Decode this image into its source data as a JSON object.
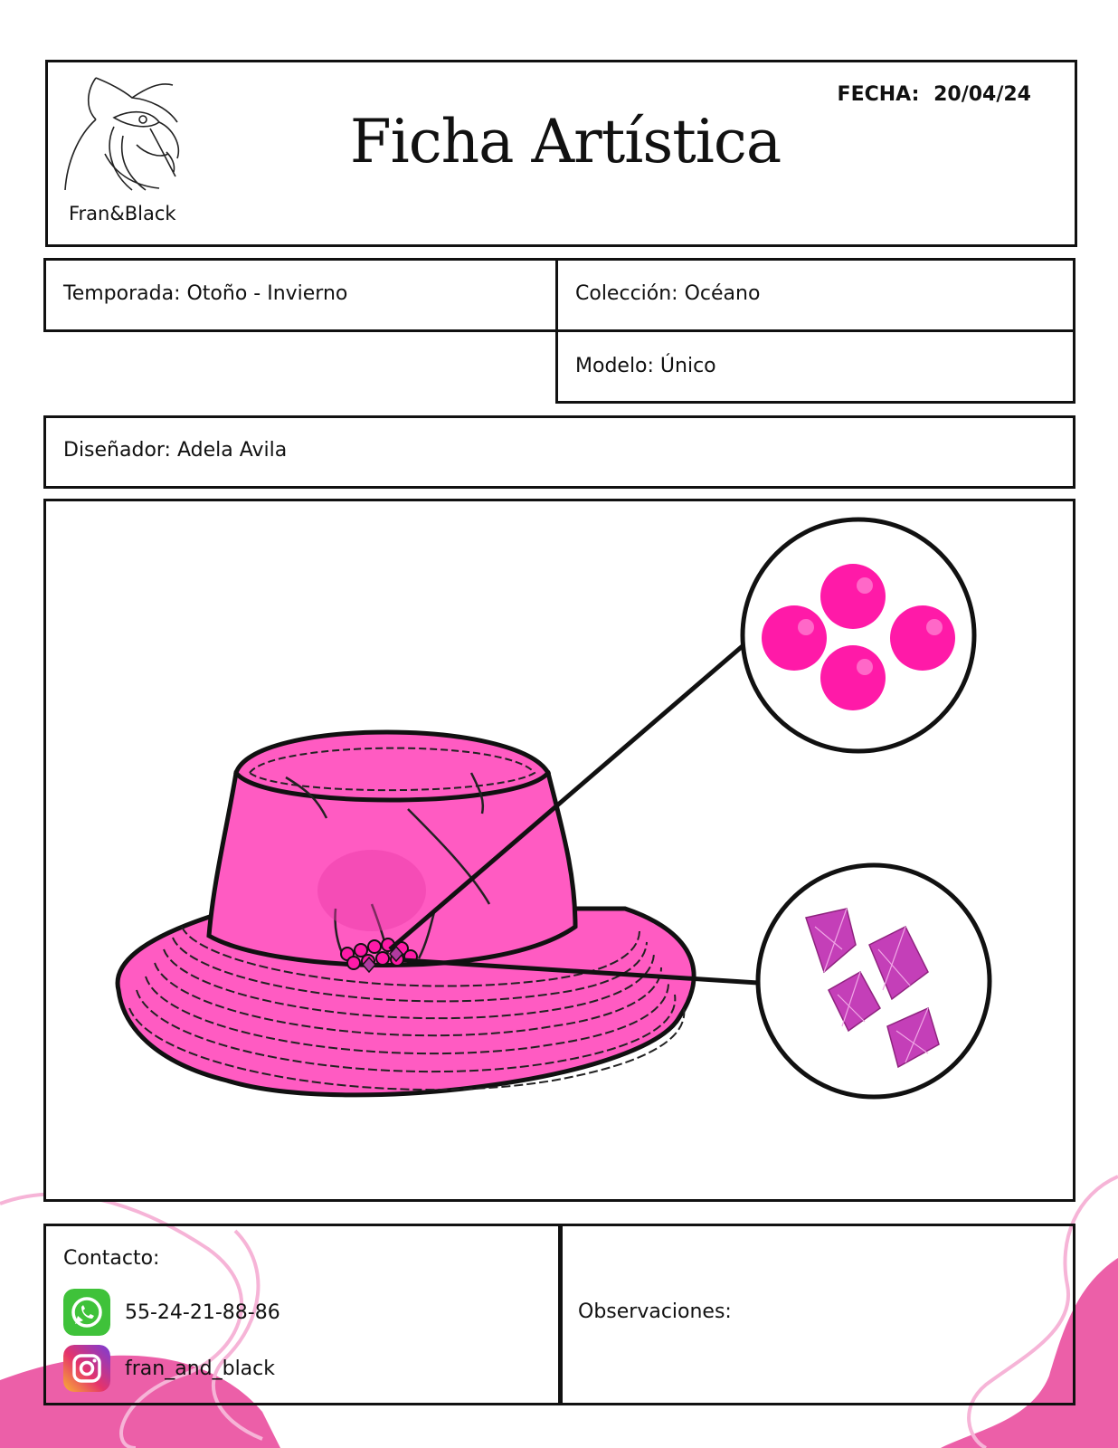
{
  "header": {
    "title": "Ficha Artística",
    "brand": "Fran&Black",
    "date_label": "FECHA:",
    "date_value": "20/04/24"
  },
  "fields": {
    "season": "Temporada: Otoño - Invierno",
    "collection": "Colección: Océano",
    "model": "Modelo: Único",
    "designer": "Diseñador: Adela Avila"
  },
  "contact": {
    "title": "Contacto:",
    "phone": "55-24-21-88-86",
    "instagram": "fran_and_black",
    "icons": [
      "whatsapp-icon",
      "instagram-icon"
    ]
  },
  "observations": {
    "label": "Observaciones:"
  },
  "colors": {
    "hat_pink": "#ff5bc2",
    "bead_magenta": "#ff1aa8",
    "crystal_purple": "#c43fb8",
    "decor_pink": "#f27ab8"
  }
}
